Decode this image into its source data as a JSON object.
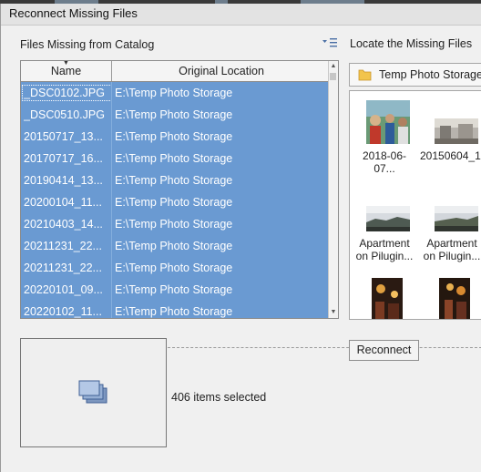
{
  "dialog": {
    "title": "Reconnect Missing Files"
  },
  "missing_panel": {
    "heading": "Files Missing from Catalog",
    "menu_icon": "sort-menu-icon",
    "columns": [
      "Name",
      "Original Location"
    ],
    "rows": [
      {
        "name": "_DSC0102.JPG",
        "location": "E:\\Temp Photo Storage"
      },
      {
        "name": "_DSC0510.JPG",
        "location": "E:\\Temp Photo Storage"
      },
      {
        "name": "20150717_13...",
        "location": "E:\\Temp Photo Storage"
      },
      {
        "name": "20170717_16...",
        "location": "E:\\Temp Photo Storage"
      },
      {
        "name": "20190414_13...",
        "location": "E:\\Temp Photo Storage"
      },
      {
        "name": "20200104_11...",
        "location": "E:\\Temp Photo Storage"
      },
      {
        "name": "20210403_14...",
        "location": "E:\\Temp Photo Storage"
      },
      {
        "name": "20211231_22...",
        "location": "E:\\Temp Photo Storage"
      },
      {
        "name": "20211231_22...",
        "location": "E:\\Temp Photo Storage"
      },
      {
        "name": "20220101_09...",
        "location": "E:\\Temp Photo Storage"
      },
      {
        "name": "20220102_11...",
        "location": "E:\\Temp Photo Storage"
      }
    ],
    "selection_color": "#6a9ad2"
  },
  "locate_panel": {
    "heading": "Locate the Missing Files",
    "folder": "Temp Photo Storage",
    "folder_icon": "folder-icon",
    "thumbnails": [
      {
        "caption": "2018-06-07...",
        "image": "photo-people-icon"
      },
      {
        "caption": "20150604_1...",
        "image": "photo-room-icon"
      },
      {
        "caption": "Apartment on Pilugin...",
        "image": "photo-sky-icon"
      },
      {
        "caption": "Apartment on Pilugin...",
        "image": "photo-sky-icon"
      },
      {
        "caption": "",
        "image": "photo-night-icon"
      },
      {
        "caption": "",
        "image": "photo-night-icon"
      }
    ]
  },
  "footer": {
    "selection_count": "406 items selected",
    "reconnect_label": "Reconnect",
    "preview_icon": "stacked-photos-icon"
  }
}
